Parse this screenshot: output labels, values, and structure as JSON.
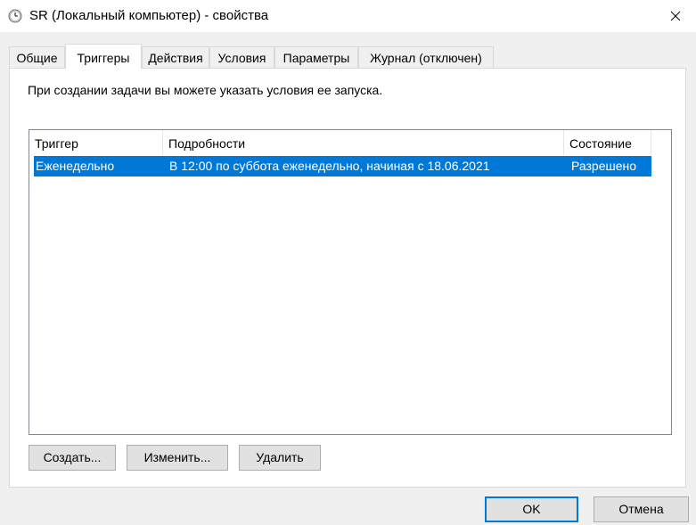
{
  "window": {
    "title": "SR (Локальный компьютер) - свойства"
  },
  "tabs": [
    {
      "label": "Общие"
    },
    {
      "label": "Триггеры"
    },
    {
      "label": "Действия"
    },
    {
      "label": "Условия"
    },
    {
      "label": "Параметры"
    },
    {
      "label": "Журнал (отключен)"
    }
  ],
  "active_tab": "Триггеры",
  "description": "При создании задачи вы можете указать условия ее запуска.",
  "table": {
    "columns": [
      "Триггер",
      "Подробности",
      "Состояние"
    ],
    "rows": [
      {
        "trigger": "Еженедельно",
        "details": "В 12:00 по суббота еженедельно, начиная с 18.06.2021",
        "status": "Разрешено",
        "selected": true
      }
    ]
  },
  "buttons": {
    "create": "Создать...",
    "edit": "Изменить...",
    "delete": "Удалить",
    "ok": "OK",
    "cancel": "Отмена"
  },
  "colors": {
    "selection": "#0078d7",
    "default_button_border": "#0078d7"
  },
  "icons": {
    "title": "clock-icon",
    "close": "close-icon"
  }
}
